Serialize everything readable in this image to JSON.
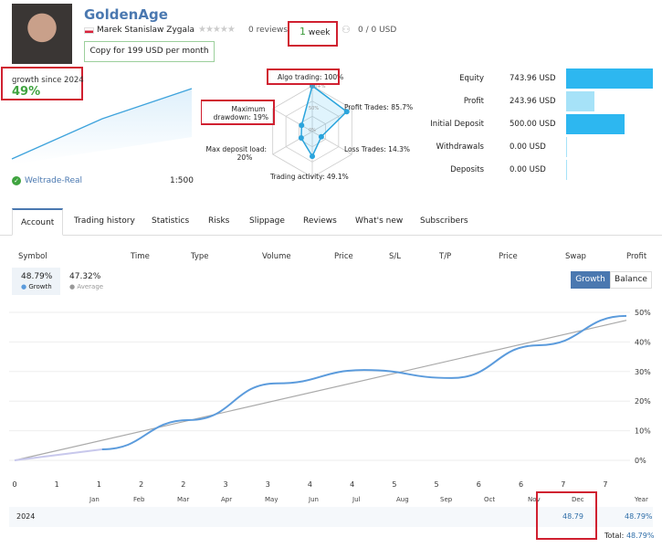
{
  "header": {
    "title": "GoldenAge",
    "author": "Marek Stanislaw Zygala",
    "reviews": "0 reviews",
    "age_num": "1",
    "age_unit": "week",
    "subscribers": "0 / 0 USD",
    "copy_button": "Copy for 199 USD per month"
  },
  "growth": {
    "label": "growth since 2024",
    "value": "49%",
    "broker": "Weltrade-Real",
    "leverage": "1:500"
  },
  "radar": {
    "algo": "Algo trading: 100%",
    "profit_trades": "Profit Trades: 85.7%",
    "loss_trades": "Loss Trades: 14.3%",
    "activity": "Trading activity: 49.1%",
    "deposit_load_1": "Max deposit load:",
    "deposit_load_2": "20%",
    "drawdown_1": "Maximum",
    "drawdown_2": "drawdown: 19%",
    "ring_100": "100+%",
    "ring_50": "50%",
    "ring_0": "0%",
    "values": {
      "algo": 100,
      "profit_trades": 85.7,
      "loss_trades": 14.3,
      "activity": 49.1,
      "deposit_load": 20,
      "drawdown": 19
    }
  },
  "stats": [
    {
      "label": "Equity",
      "value": "743.96 USD",
      "fill": 1.0,
      "color": "#2db7f0"
    },
    {
      "label": "Profit",
      "value": "243.96 USD",
      "fill": 0.33,
      "color": "#a6e2f8"
    },
    {
      "label": "Initial Deposit",
      "value": "500.00 USD",
      "fill": 0.67,
      "color": "#2db7f0"
    },
    {
      "label": "Withdrawals",
      "value": "0.00 USD",
      "fill": 0,
      "color": "#2db7f0"
    },
    {
      "label": "Deposits",
      "value": "0.00 USD",
      "fill": 0,
      "color": "#2db7f0"
    }
  ],
  "tabs": [
    "Account",
    "Trading history",
    "Statistics",
    "Risks",
    "Slippage",
    "Reviews",
    "What's new",
    "Subscribers"
  ],
  "columns": [
    "Symbol",
    "Time",
    "Type",
    "Volume",
    "Price",
    "S/L",
    "T/P",
    "Price",
    "Swap",
    "Profit"
  ],
  "legend": {
    "growth_value": "48.79%",
    "growth_label": "Growth",
    "average_value": "47.32%",
    "average_label": "Average"
  },
  "toggle": {
    "growth": "Growth",
    "balance": "Balance"
  },
  "chart_data": {
    "type": "line",
    "x_tick_labels": [
      "0",
      "1",
      "1",
      "2",
      "2",
      "3",
      "3",
      "4",
      "4",
      "5",
      "5",
      "6",
      "6",
      "7",
      "7"
    ],
    "xlim": [
      0,
      7
    ],
    "ylim": [
      0,
      50
    ],
    "y_ticks": [
      "0%",
      "10%",
      "20%",
      "30%",
      "40%",
      "50%"
    ],
    "grid": "horizontal",
    "series": [
      {
        "name": "Growth",
        "color": "#5b9bdc",
        "x": [
          0,
          1,
          2,
          3,
          4,
          5,
          6,
          7
        ],
        "y": [
          0,
          3.7,
          13.6,
          26,
          30.5,
          27.8,
          38.9,
          48.79
        ]
      },
      {
        "name": "Average",
        "color": "#aaaaaa",
        "x": [
          0,
          7
        ],
        "y": [
          0,
          47.32
        ]
      }
    ]
  },
  "monthly": {
    "months": [
      "Jan",
      "Feb",
      "Mar",
      "Apr",
      "May",
      "Jun",
      "Jul",
      "Aug",
      "Sep",
      "Oct",
      "Nov",
      "Dec",
      "Year"
    ],
    "year": "2024",
    "dec": "48.79",
    "year_total": "48.79%",
    "total_label": "Total:",
    "total": "48.79%"
  }
}
